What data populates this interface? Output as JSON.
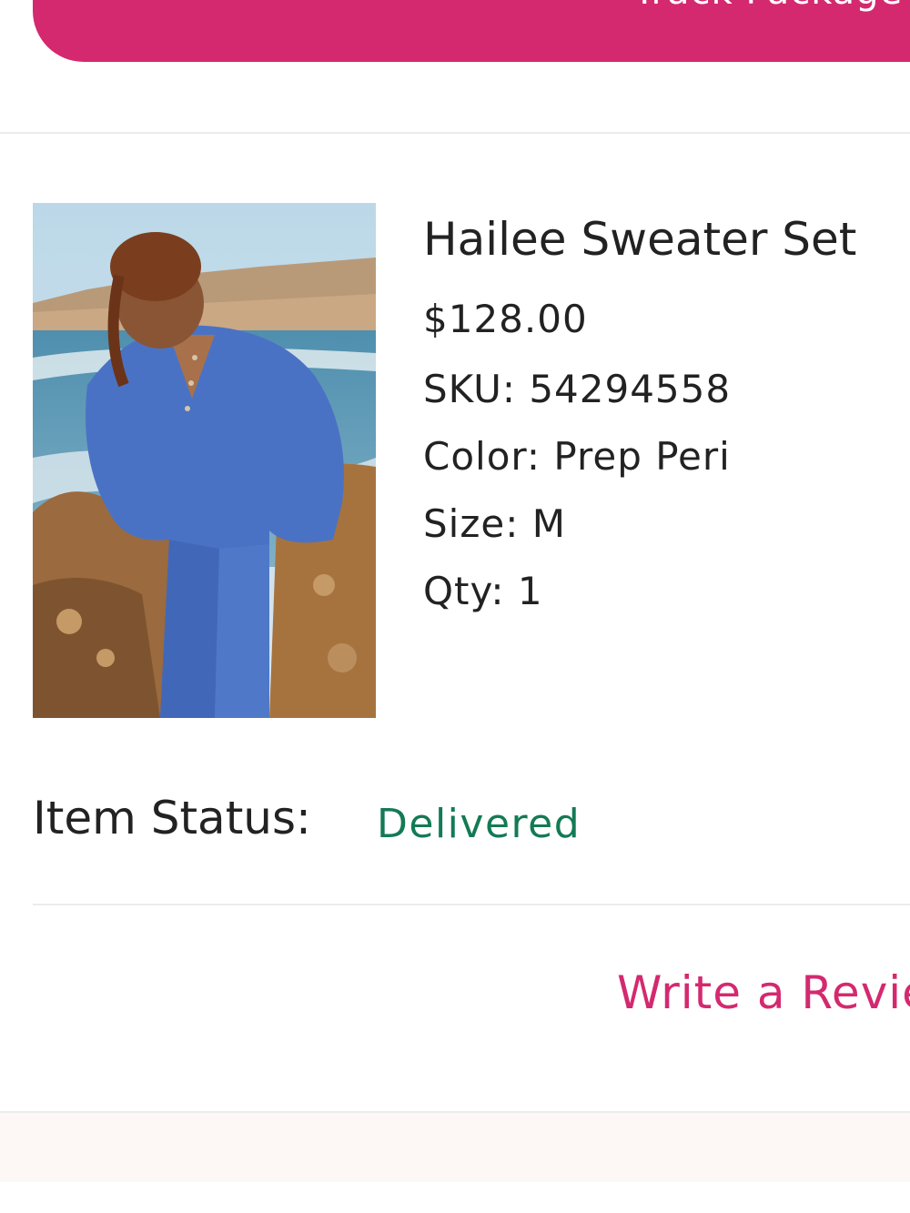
{
  "header": {
    "track_button_label": "Track Package",
    "accent_color": "#d4296f"
  },
  "product": {
    "image_icon": "product-photo",
    "name": "Hailee Sweater Set",
    "price": "$128.00",
    "sku": "SKU: 54294558",
    "color": "Color: Prep Peri",
    "size": "Size: M",
    "qty": "Qty: 1"
  },
  "status": {
    "label": "Item Status:",
    "value": "Delivered",
    "value_color": "#137a55"
  },
  "actions": {
    "write_review": "Write a Review"
  }
}
